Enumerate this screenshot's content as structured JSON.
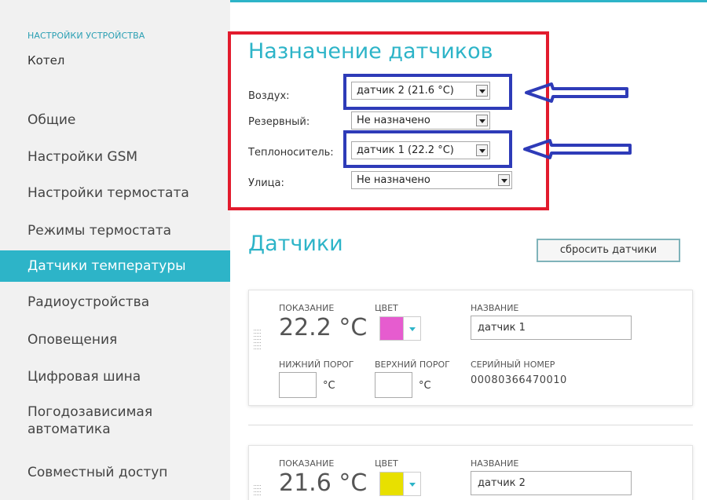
{
  "sidebar": {
    "heading": "НАСТРОЙКИ УСТРОЙСТВА",
    "device": "Котел",
    "items": [
      {
        "label": "Общие"
      },
      {
        "label": "Настройки GSM"
      },
      {
        "label": "Настройки термостата"
      },
      {
        "label": "Режимы термостата"
      },
      {
        "label": "Датчики температуры",
        "active": true
      },
      {
        "label": "Радиоустройства"
      },
      {
        "label": "Оповещения"
      },
      {
        "label": "Цифровая шина"
      },
      {
        "label": "Погодозависимая автоматика"
      },
      {
        "label": "Совместный доступ"
      }
    ]
  },
  "assignment": {
    "title": "Назначение датчиков",
    "rows": [
      {
        "label": "Воздух:",
        "value": "датчик 2 (21.6 °C)"
      },
      {
        "label": "Резервный:",
        "value": "Не назначено"
      },
      {
        "label": "Теплоноситель:",
        "value": "датчик 1 (22.2 °C)"
      },
      {
        "label": "Улица:",
        "value": "Не назначено"
      }
    ]
  },
  "sensors": {
    "title": "Датчики",
    "reset_label": "сбросить датчики",
    "labels": {
      "reading": "ПОКАЗАНИЕ",
      "color": "ЦВЕТ",
      "name": "НАЗВАНИЕ",
      "low": "НИЖНИЙ ПОРОГ",
      "high": "ВЕРХНИЙ ПОРОГ",
      "serial": "СЕРИЙНЫЙ НОМЕР",
      "unit": "°C"
    },
    "cards": [
      {
        "reading": "22.2 °C",
        "color": "#e65ccf",
        "name": "датчик 1",
        "serial": "00080366470010"
      },
      {
        "reading": "21.6 °C",
        "color": "#e8e000",
        "name": "датчик 2"
      }
    ]
  },
  "colors": {
    "accent": "#2db4c8",
    "highlight_red": "#e21b2d",
    "highlight_blue": "#2e3bb8"
  }
}
